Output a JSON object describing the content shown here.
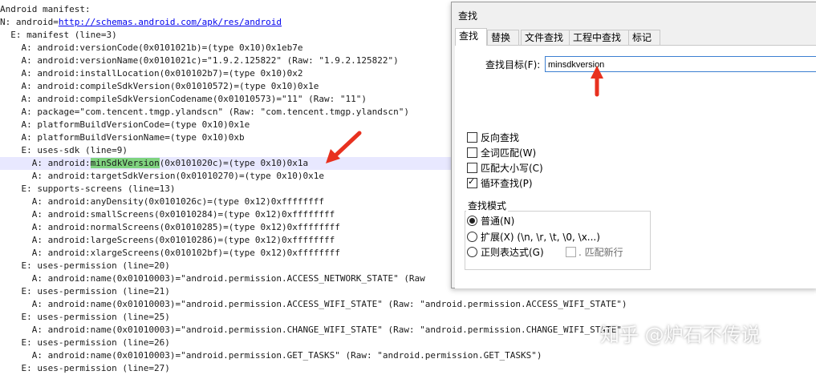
{
  "editor": {
    "lines": [
      "Android manifest:",
      "N: android=",
      "  E: manifest (line=3)",
      "    A: android:versionCode(0x0101021b)=(type 0x10)0x1eb7e",
      "    A: android:versionName(0x0101021c)=\"1.9.2.125822\" (Raw: \"1.9.2.125822\")",
      "    A: android:installLocation(0x010102b7)=(type 0x10)0x2",
      "    A: android:compileSdkVersion(0x01010572)=(type 0x10)0x1e",
      "    A: android:compileSdkVersionCodename(0x01010573)=\"11\" (Raw: \"11\")",
      "    A: package=\"com.tencent.tmgp.ylandscn\" (Raw: \"com.tencent.tmgp.ylandscn\")",
      "    A: platformBuildVersionCode=(type 0x10)0x1e",
      "    A: platformBuildVersionName=(type 0x10)0xb",
      "    E: uses-sdk (line=9)",
      "      A: android:",
      "      A: android:targetSdkVersion(0x01010270)=(type 0x10)0x1e",
      "    E: supports-screens (line=13)",
      "      A: android:anyDensity(0x0101026c)=(type 0x12)0xffffffff",
      "      A: android:smallScreens(0x01010284)=(type 0x12)0xffffffff",
      "      A: android:normalScreens(0x01010285)=(type 0x12)0xffffffff",
      "      A: android:largeScreens(0x01010286)=(type 0x12)0xffffffff",
      "      A: android:xlargeScreens(0x010102bf)=(type 0x12)0xffffffff",
      "    E: uses-permission (line=20)",
      "      A: android:name(0x01010003)=\"android.permission.ACCESS_NETWORK_STATE\" (Raw",
      "    E: uses-permission (line=21)",
      "      A: android:name(0x01010003)=\"android.permission.ACCESS_WIFI_STATE\" (Raw: \"android.permission.ACCESS_WIFI_STATE\")",
      "    E: uses-permission (line=25)",
      "      A: android:name(0x01010003)=\"android.permission.CHANGE_WIFI_STATE\" (Raw: \"android.permission.CHANGE_WIFI_STATE\"",
      "    E: uses-permission (line=26)",
      "      A: android:name(0x01010003)=\"android.permission.GET_TASKS\" (Raw: \"android.permission.GET_TASKS\")",
      "    E: uses-permission (line=27)"
    ],
    "link_text": "http://schemas.android.com/apk/res/android",
    "highlight_text": "minSdkVersion",
    "highlight_rest": "(0x0101020c)=(type 0x10)0x1a"
  },
  "dialog": {
    "title": "查找",
    "tabs": [
      "查找",
      "替换",
      "文件查找",
      "工程中查找",
      "标记"
    ],
    "find_label": "查找目标(F):",
    "find_value": "minsdkversion",
    "options": [
      {
        "label": "反向查找",
        "checked": false
      },
      {
        "label": "全词匹配(W)",
        "checked": false
      },
      {
        "label": "匹配大小写(C)",
        "checked": false
      },
      {
        "label": "循环查找(P)",
        "checked": true
      }
    ],
    "mode_title": "查找模式",
    "modes": [
      {
        "label": "普通(N)",
        "selected": true
      },
      {
        "label": "扩展(X) (\\n, \\r, \\t, \\0, \\x...)",
        "selected": false
      },
      {
        "label": "正则表达式(G)",
        "selected": false
      }
    ],
    "newline_label": ". 匹配新行"
  },
  "watermark": "知乎 @炉石不传说",
  "colors": {
    "highlight": "#7fd37f",
    "arrow": "#e8311f",
    "focus_border": "#3c7fd1"
  }
}
